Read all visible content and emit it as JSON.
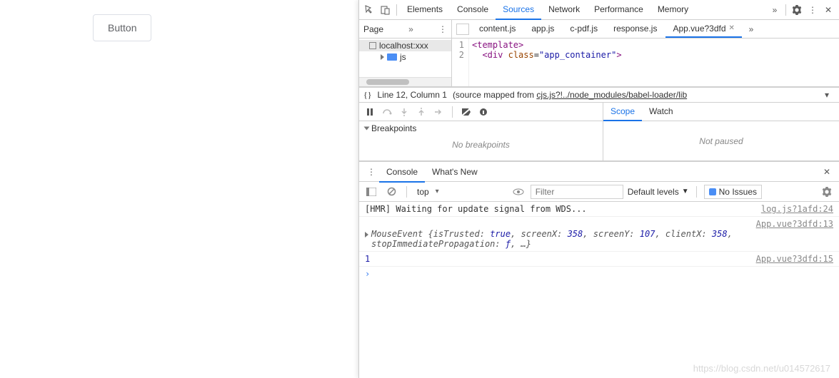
{
  "page": {
    "button_label": "Button"
  },
  "devtools": {
    "panels": [
      "Elements",
      "Console",
      "Sources",
      "Network",
      "Performance",
      "Memory"
    ],
    "panels_active": "Sources",
    "page_label": "Page",
    "tree_root": "localhost:xxx",
    "tree_folder": "js",
    "file_tabs": [
      "content.js",
      "app.js",
      "c-pdf.js",
      "response.js",
      "App.vue?3dfd"
    ],
    "file_tab_active": "App.vue?3dfd",
    "code_lines": [
      {
        "n": 1,
        "html": "<span class='tag'>&lt;template&gt;</span>"
      },
      {
        "n": 2,
        "html": "&nbsp;&nbsp;<span class='tag'>&lt;div</span> <span class='attr-name'>class</span>=<span class='attr-val'>\"app_container\"</span><span class='tag'>&gt;</span>"
      }
    ],
    "status_line_col": "Line 12, Column 1",
    "status_mapped": "(source mapped from ",
    "status_link": "cjs.js?!../node_modules/babel-loader/lib",
    "breakpoints_label": "Breakpoints",
    "no_breakpoints": "No breakpoints",
    "scope_tabs": [
      "Scope",
      "Watch"
    ],
    "scope_active": "Scope",
    "not_paused": "Not paused",
    "console_tabs": [
      "Console",
      "What's New"
    ],
    "console_active": "Console",
    "context": "top",
    "filter_placeholder": "Filter",
    "levels_label": "Default levels",
    "no_issues_label": "No Issues",
    "log_hmr": "[HMR] Waiting for update signal from WDS...",
    "log_hmr_src": "log.js?1afd:24",
    "log_event_src1": "App.vue?3dfd:13",
    "log_event_prefix": "MouseEvent ",
    "log_event_obj": "{isTrusted: <span class='kw-true'>true</span>, screenX: <span class='kw-num'>358</span>, screenY: <span class='kw-num'>107</span>, clientX: <span class='kw-num'>358</span>, stopImmediatePropagation: <span class='kw-func'>ƒ</span>, …}",
    "log_one": "1",
    "log_one_src": "App.vue?3dfd:15"
  },
  "watermark": "https://blog.csdn.net/u014572617"
}
